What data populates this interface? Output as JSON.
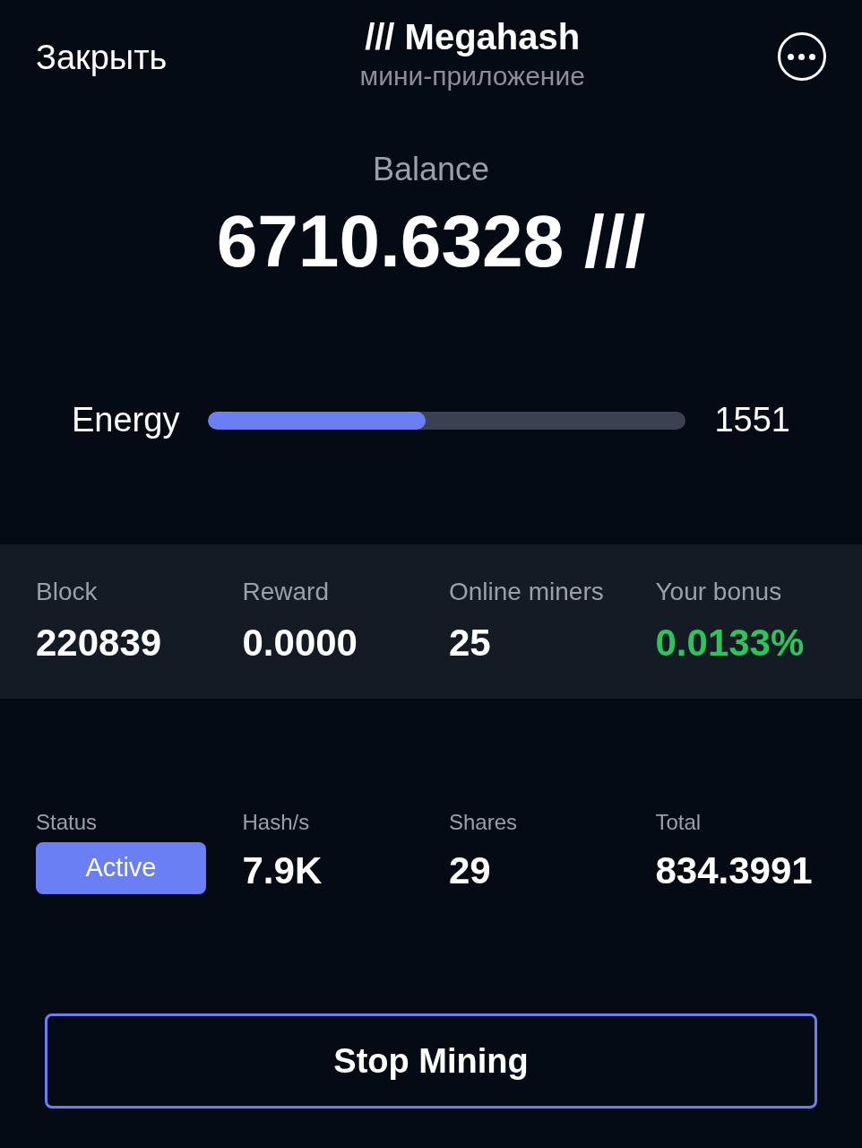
{
  "header": {
    "close": "Закрыть",
    "title": "/// Megahash",
    "subtitle": "мини-приложение"
  },
  "balance": {
    "label": "Balance",
    "value": "6710.6328 ///"
  },
  "energy": {
    "label": "Energy",
    "level": 0.456,
    "value": "1551"
  },
  "stats": [
    {
      "label": "Block",
      "value": "220839",
      "highlight": false
    },
    {
      "label": "Reward",
      "value": "0.0000",
      "highlight": false
    },
    {
      "label": "Online miners",
      "value": "25",
      "highlight": false
    },
    {
      "label": "Your bonus",
      "value": "0.0133%",
      "highlight": true
    }
  ],
  "mining": [
    {
      "kind": "badge",
      "label": "Status",
      "value": "Active"
    },
    {
      "kind": "text",
      "label": "Hash/s",
      "value": "7.9K"
    },
    {
      "kind": "text",
      "label": "Shares",
      "value": "29"
    },
    {
      "kind": "text",
      "label": "Total",
      "value": "834.3991"
    }
  ],
  "action": {
    "label": "Stop Mining"
  }
}
